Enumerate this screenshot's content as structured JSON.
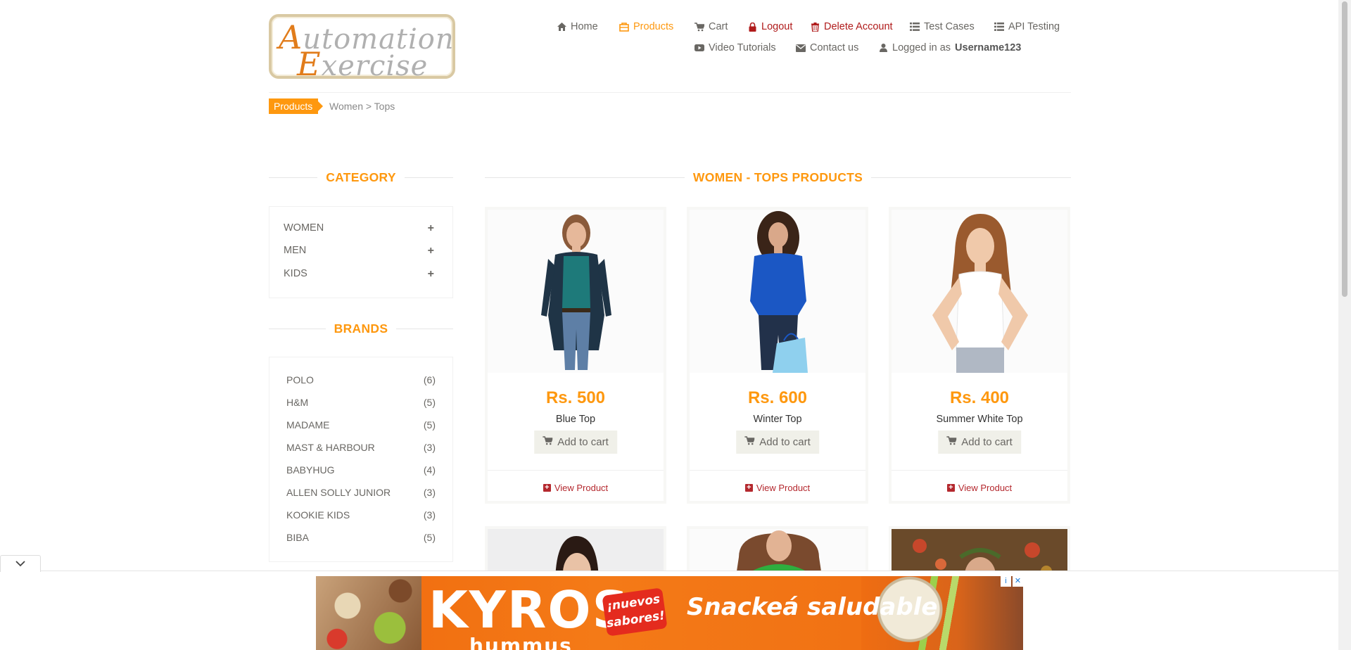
{
  "header": {
    "logo_line1": [
      "A",
      "utomation"
    ],
    "logo_line2": [
      "E",
      "xercise"
    ],
    "nav": {
      "home": "Home",
      "products": "Products",
      "cart": "Cart",
      "logout": "Logout",
      "delete_account": "Delete Account",
      "test_cases": "Test Cases",
      "api_testing": "API Testing",
      "video_tutorials": "Video Tutorials",
      "contact_us": "Contact us",
      "logged_in_prefix": "Logged in as",
      "username": "Username123"
    }
  },
  "breadcrumb": {
    "tag": "Products",
    "path": "Women > Tops"
  },
  "sidebar": {
    "category_title": "CATEGORY",
    "categories": [
      {
        "label": "WOMEN",
        "toggle": "+"
      },
      {
        "label": "MEN",
        "toggle": "+"
      },
      {
        "label": "KIDS",
        "toggle": "+"
      }
    ],
    "brands_title": "BRANDS",
    "brands": [
      {
        "label": "POLO",
        "count": "(6)"
      },
      {
        "label": "H&M",
        "count": "(5)"
      },
      {
        "label": "MADAME",
        "count": "(5)"
      },
      {
        "label": "MAST & HARBOUR",
        "count": "(3)"
      },
      {
        "label": "BABYHUG",
        "count": "(4)"
      },
      {
        "label": "ALLEN SOLLY JUNIOR",
        "count": "(3)"
      },
      {
        "label": "KOOKIE KIDS",
        "count": "(3)"
      },
      {
        "label": "BIBA",
        "count": "(5)"
      }
    ]
  },
  "main": {
    "title": "WOMEN - TOPS PRODUCTS",
    "products": [
      {
        "price": "Rs. 500",
        "name": "Blue Top",
        "add_label": "Add to cart",
        "view_label": "View Product"
      },
      {
        "price": "Rs. 600",
        "name": "Winter Top",
        "add_label": "Add to cart",
        "view_label": "View Product"
      },
      {
        "price": "Rs. 400",
        "name": "Summer White Top",
        "add_label": "Add to cart",
        "view_label": "View Product"
      }
    ]
  },
  "ad": {
    "brand": "KYROS",
    "sub": "hummus",
    "badge_line1": "¡nuevos",
    "badge_line2": "sabores!",
    "slogan": "Snackeá saludable",
    "info": "i",
    "close": "✕"
  },
  "colors": {
    "accent": "#fe980f",
    "danger": "#b01b1b",
    "view_link": "#b4282e"
  }
}
